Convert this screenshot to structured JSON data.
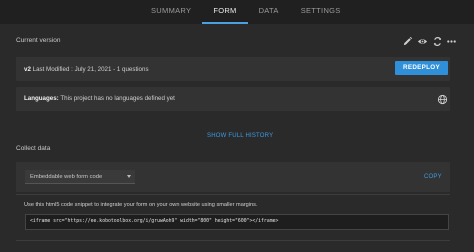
{
  "tabs": [
    {
      "label": "SUMMARY",
      "active": false
    },
    {
      "label": "FORM",
      "active": true
    },
    {
      "label": "DATA",
      "active": false
    },
    {
      "label": "SETTINGS",
      "active": false
    }
  ],
  "current_version": {
    "title": "Current version",
    "icons": [
      "pencil-icon",
      "eye-icon",
      "clone-icon",
      "more-icon"
    ],
    "version_label": "v2",
    "last_modified": "Last Modified : July 21, 2021 - 1 questions",
    "redeploy_label": "REDEPLOY"
  },
  "languages": {
    "label": "Languages:",
    "text": "This project has no languages defined yet",
    "icon": "globe-icon"
  },
  "history": {
    "show_full_history_label": "SHOW FULL HISTORY"
  },
  "collect": {
    "title": "Collect data",
    "select_value": "Embeddable web form code",
    "copy_label": "COPY",
    "description": "Use this html5 code snippet to integrate your form on your own website using smaller margins.",
    "code": "<iframe src=\"https://ee.kobotoolbox.org/i/gruwAoh9\" width=\"800\" height=\"600\"></iframe>"
  },
  "colors": {
    "accent": "#2f8fd8",
    "background": "#2a2a2a",
    "topbar": "#202020"
  }
}
